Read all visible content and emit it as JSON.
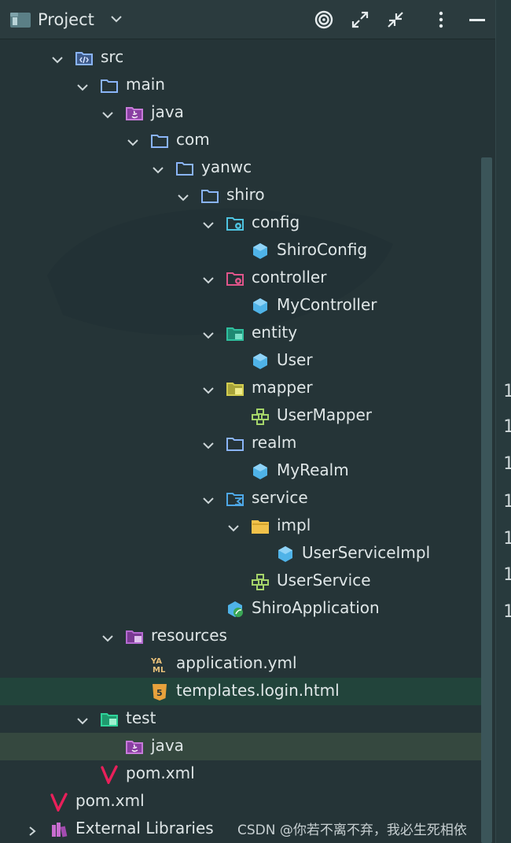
{
  "header": {
    "title": "Project",
    "buttons": [
      "target-icon",
      "expand-all-icon",
      "collapse-all-icon",
      "more-options-icon",
      "hide-panel-icon"
    ]
  },
  "tree": [
    {
      "label": "src",
      "indent": 0,
      "icon": "source-folder-icon",
      "arrow": "open"
    },
    {
      "label": "main",
      "indent": 1,
      "icon": "folder-icon",
      "arrow": "open"
    },
    {
      "label": "java",
      "indent": 2,
      "icon": "java-source-folder-icon",
      "arrow": "open"
    },
    {
      "label": "com",
      "indent": 3,
      "icon": "package-folder-icon",
      "arrow": "open"
    },
    {
      "label": "yanwc",
      "indent": 4,
      "icon": "package-folder-icon",
      "arrow": "open"
    },
    {
      "label": "shiro",
      "indent": 5,
      "icon": "package-folder-icon",
      "arrow": "open"
    },
    {
      "label": "config",
      "indent": 6,
      "icon": "config-folder-icon",
      "arrow": "open"
    },
    {
      "label": "ShiroConfig",
      "indent": 7,
      "icon": "class-icon",
      "arrow": "none"
    },
    {
      "label": "controller",
      "indent": 6,
      "icon": "controller-folder-icon",
      "arrow": "open"
    },
    {
      "label": "MyController",
      "indent": 7,
      "icon": "class-icon",
      "arrow": "none"
    },
    {
      "label": "entity",
      "indent": 6,
      "icon": "entity-folder-icon",
      "arrow": "open"
    },
    {
      "label": "User",
      "indent": 7,
      "icon": "class-icon",
      "arrow": "none"
    },
    {
      "label": "mapper",
      "indent": 6,
      "icon": "mapper-folder-icon",
      "arrow": "open"
    },
    {
      "label": "UserMapper",
      "indent": 7,
      "icon": "interface-icon",
      "arrow": "none"
    },
    {
      "label": "realm",
      "indent": 6,
      "icon": "package-folder-icon",
      "arrow": "open"
    },
    {
      "label": "MyRealm",
      "indent": 7,
      "icon": "class-icon",
      "arrow": "none"
    },
    {
      "label": "service",
      "indent": 6,
      "icon": "service-folder-icon",
      "arrow": "open"
    },
    {
      "label": "impl",
      "indent": 7,
      "icon": "impl-folder-icon",
      "arrow": "open"
    },
    {
      "label": "UserServiceImpl",
      "indent": 8,
      "icon": "class-icon",
      "arrow": "none"
    },
    {
      "label": "UserService",
      "indent": 7,
      "icon": "interface-icon",
      "arrow": "none"
    },
    {
      "label": "ShiroApplication",
      "indent": 6,
      "icon": "spring-app-icon",
      "arrow": "none"
    },
    {
      "label": "resources",
      "indent": 2,
      "icon": "resources-folder-icon",
      "arrow": "open"
    },
    {
      "label": "application.yml",
      "indent": 3,
      "icon": "yaml-file-icon",
      "arrow": "none"
    },
    {
      "label": "templates.login.html",
      "indent": 3,
      "icon": "html-file-icon",
      "arrow": "none",
      "state": "selected"
    },
    {
      "label": "test",
      "indent": 1,
      "icon": "test-folder-icon",
      "arrow": "open"
    },
    {
      "label": "java",
      "indent": 2,
      "icon": "java-source-folder-icon",
      "arrow": "none",
      "state": "hover"
    },
    {
      "label": "pom.xml",
      "indent": 1,
      "icon": "maven-icon",
      "arrow": "none"
    },
    {
      "label": "pom.xml",
      "indent": 0,
      "icon": "maven-icon",
      "arrow": "none",
      "shift": -1
    },
    {
      "label": "External Libraries",
      "indent": -1,
      "icon": "libraries-icon",
      "arrow": "closed"
    }
  ],
  "gutter_digits": [
    "1",
    "1",
    "1",
    "1",
    "1",
    "1",
    "1"
  ],
  "watermark": "CSDN @你若不离不弃，我必生死相依",
  "colors": {
    "background": "#253437",
    "selected_row": "#22443b",
    "hover_row": "#35483f",
    "folder_blue": "#8ab4f8",
    "class_blue": "#4fb3e8",
    "interface_green": "#a5d46a"
  }
}
